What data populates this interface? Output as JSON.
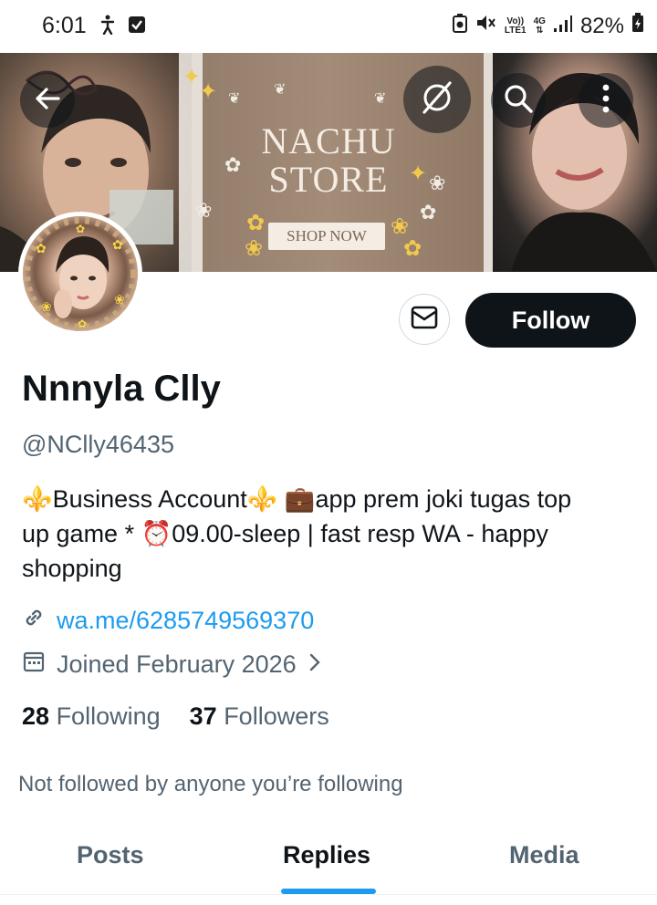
{
  "status_bar": {
    "time": "6:01",
    "battery": "82%",
    "network_volte": "Vo))",
    "network_lte": "LTE1",
    "network_4g": "4G"
  },
  "banner": {
    "title_line1": "NACHU",
    "title_line2": "STORE",
    "cta": "SHOP NOW"
  },
  "profile": {
    "name": "Nnnyla Clly",
    "handle": "@NClly46435",
    "bio_line1": "⚜️Business Account⚜️ 💼app prem joki tugas top",
    "bio_line2": "up game * ⏰09.00-sleep | fast resp WA - happy",
    "bio_line3": "shopping",
    "link": "wa.me/6285749569370",
    "joined": "Joined February 2026",
    "following_count": "28",
    "following_label": "Following",
    "followers_count": "37",
    "followers_label": "Followers",
    "mutuals_note": "Not followed by anyone you’re following"
  },
  "actions": {
    "follow_label": "Follow"
  },
  "tabs": [
    {
      "label": "Posts"
    },
    {
      "label": "Replies"
    },
    {
      "label": "Media"
    }
  ],
  "colors": {
    "accent": "#1d9bf0",
    "primary_text": "#0f1419",
    "secondary_text": "#536471"
  }
}
